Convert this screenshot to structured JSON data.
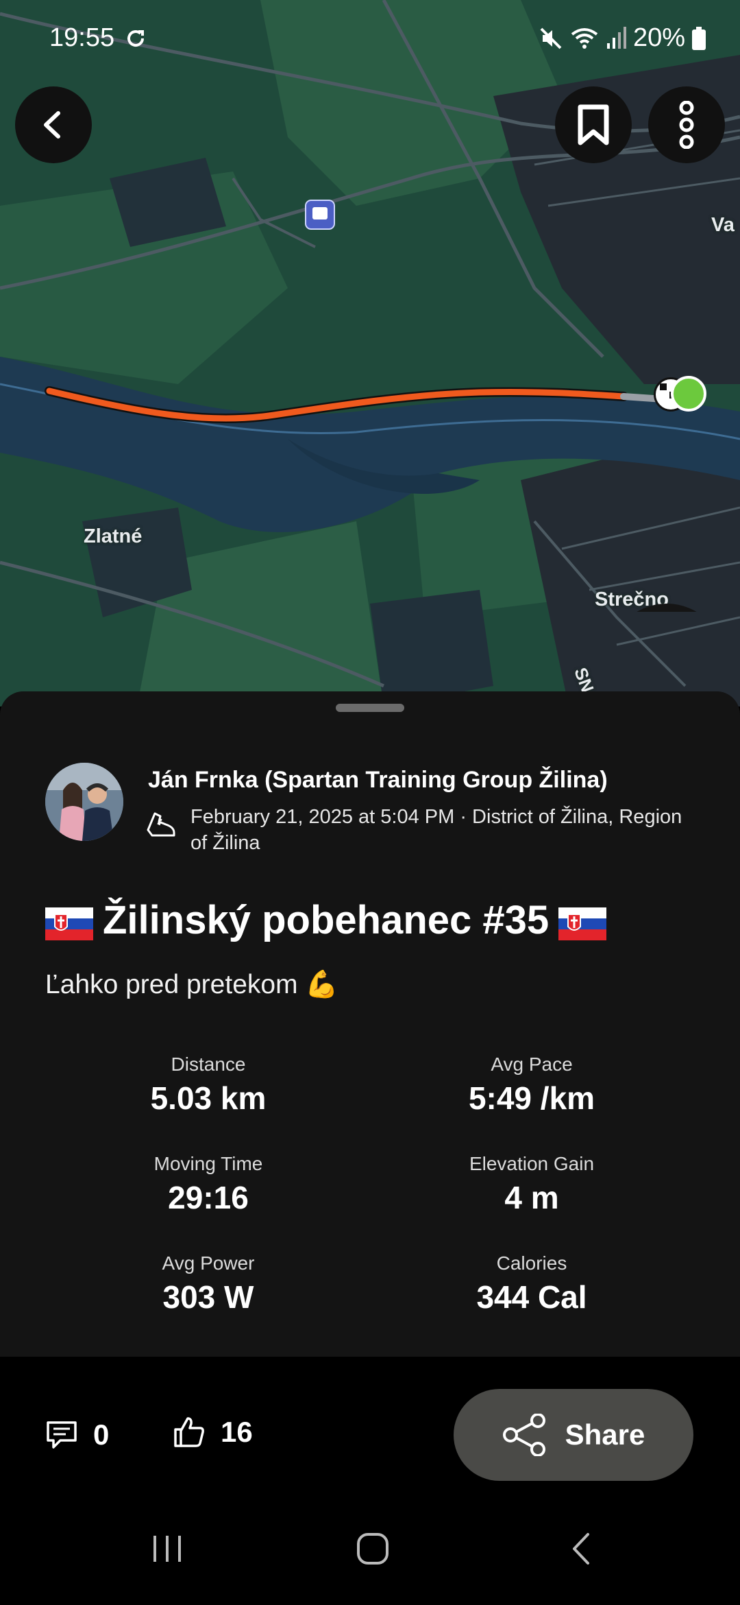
{
  "status_bar": {
    "time": "19:55",
    "battery": "20%"
  },
  "map": {
    "labels": {
      "zlatne": "Zlatné",
      "strecno": "Strečno",
      "va": "Va",
      "sn": "SN"
    },
    "route_color": "#f05a1e",
    "endpoint_color": "#6cc93d"
  },
  "toolbar": {
    "back_icon": "chevron-left-icon",
    "bookmark_icon": "bookmark-icon",
    "more_icon": "more-vertical-icon",
    "play_icon": "play-icon"
  },
  "activity": {
    "athlete_name": "Ján Frnka (Spartan Training Group Žilina)",
    "meta": "February 21, 2025 at 5:04 PM · District of Žilina, Region of Žilina",
    "title": "Žilinský pobehanec #35",
    "description": "Ľahko pred pretekom 💪"
  },
  "stats": [
    {
      "label": "Distance",
      "value": "5.03 km"
    },
    {
      "label": "Avg Pace",
      "value": "5:49 /km"
    },
    {
      "label": "Moving Time",
      "value": "29:16"
    },
    {
      "label": "Elevation Gain",
      "value": "4 m"
    },
    {
      "label": "Avg Power",
      "value": "303 W"
    },
    {
      "label": "Calories",
      "value": "344 Cal"
    }
  ],
  "actions": {
    "comments": "0",
    "kudos": "16",
    "share_label": "Share"
  },
  "colors": {
    "sheet_bg": "#141414",
    "share_bg": "#4a4a47",
    "map_land": "#1f4a3b",
    "map_water": "#1e3a52"
  }
}
